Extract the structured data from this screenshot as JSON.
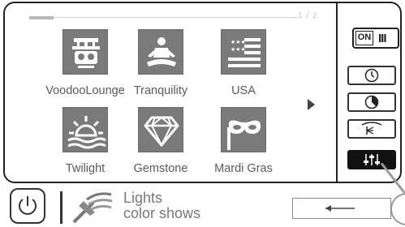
{
  "pager": {
    "indicator": "1 / 2",
    "progress": 0.5
  },
  "tiles": [
    {
      "label": "VoodooLounge",
      "icon": "voodoo-mask-icon"
    },
    {
      "label": "Tranquility",
      "icon": "meditation-icon"
    },
    {
      "label": "USA",
      "icon": "flag-icon"
    },
    {
      "label": "Twilight",
      "icon": "sunset-icon"
    },
    {
      "label": "Gemstone",
      "icon": "diamond-icon"
    },
    {
      "label": "Mardi Gras",
      "icon": "masquerade-mask-icon"
    }
  ],
  "side_panel": {
    "on_label": "ON",
    "bars_label": "III",
    "buttons": [
      {
        "icon": "clock-icon",
        "active": false
      },
      {
        "icon": "timer-icon",
        "active": false
      },
      {
        "icon": "light-beam-icon",
        "active": false
      },
      {
        "icon": "sliders-icon",
        "active": true
      }
    ]
  },
  "bottom": {
    "title": "Lights",
    "subtitle": "color shows",
    "power_icon": "power-icon",
    "lights_icon": "pool-light-icon",
    "back_icon": "left-arrow-icon"
  },
  "colors": {
    "tile_bg": "#7a7a7a",
    "border": "#222222",
    "active_button": "#111111"
  }
}
